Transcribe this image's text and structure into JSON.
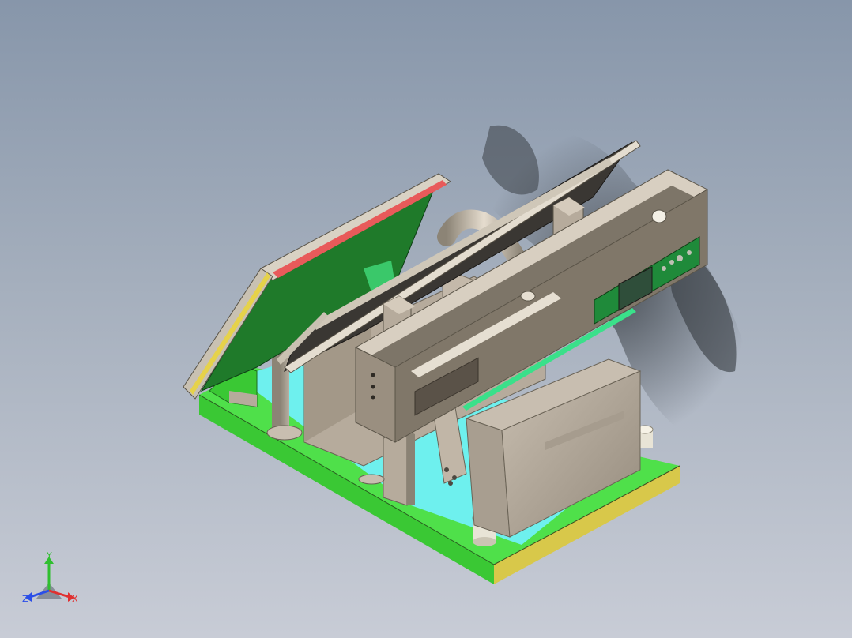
{
  "viewport": {
    "background_top": "#8796aa",
    "background_bottom": "#c8ccd6"
  },
  "colors": {
    "base_top": "#4fe04a",
    "base_side": "#d8c84a",
    "base_cyan": "#6ef0ee",
    "steel": "#b6ab9c",
    "steel_dark": "#736b60",
    "panel_dark": "#3a3733",
    "pcb_green": "#1f7a2a",
    "pcb_light": "#3ac86a",
    "tube": "#cfc6b8",
    "accent_red": "#e85a5a",
    "accent_yellow": "#e6d24a"
  },
  "triad": {
    "x_label": "X",
    "y_label": "Y",
    "z_label": "Z",
    "x_color": "#e03030",
    "y_color": "#2fbf2f",
    "z_color": "#2a4ee8"
  }
}
